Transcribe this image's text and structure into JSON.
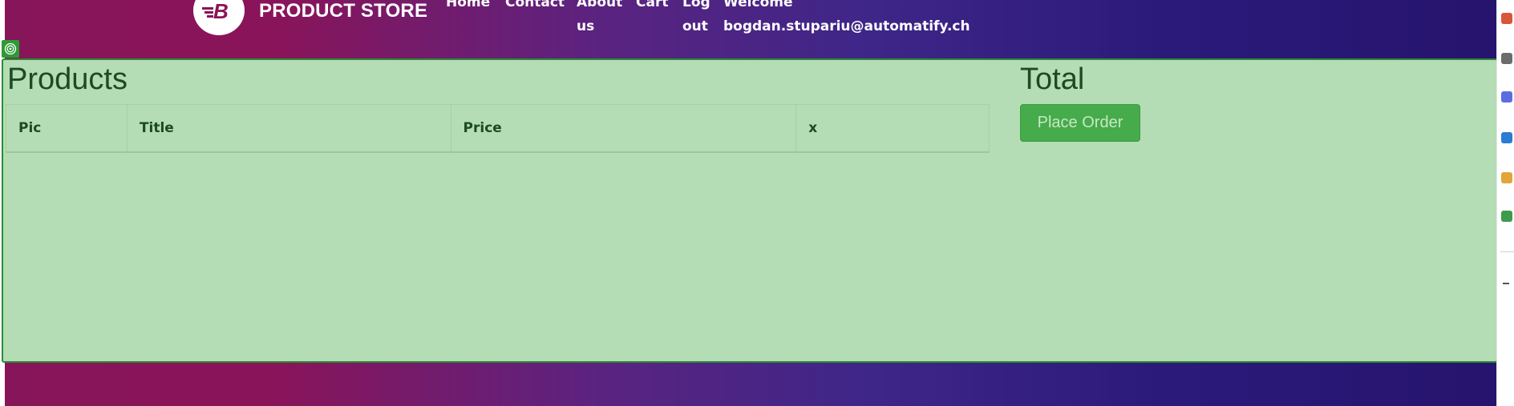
{
  "navbar": {
    "brand_name": "PRODUCT STORE",
    "links": [
      {
        "line1": "Home",
        "line2": ""
      },
      {
        "line1": "Contact",
        "line2": ""
      },
      {
        "line1": "About",
        "line2": "us"
      },
      {
        "line1": "Cart",
        "line2": ""
      },
      {
        "line1": "Log",
        "line2": "out"
      },
      {
        "line1": "Welcome",
        "line2": "bogdan.stupariu@automatify.ch"
      }
    ]
  },
  "main": {
    "products_heading": "Products",
    "total_heading": "Total",
    "place_order_label": "Place Order",
    "table": {
      "columns": [
        "Pic",
        "Title",
        "Price",
        "x"
      ],
      "rows": []
    }
  },
  "colors": {
    "gradient_start": "#871559",
    "gradient_end": "#26146e",
    "highlight_fill": "#b4ddb5",
    "highlight_border": "#2d8a35",
    "button": "#46ab4a"
  },
  "icons": {
    "brand": "brand-b-logo-icon",
    "highlight": "target-icon"
  }
}
